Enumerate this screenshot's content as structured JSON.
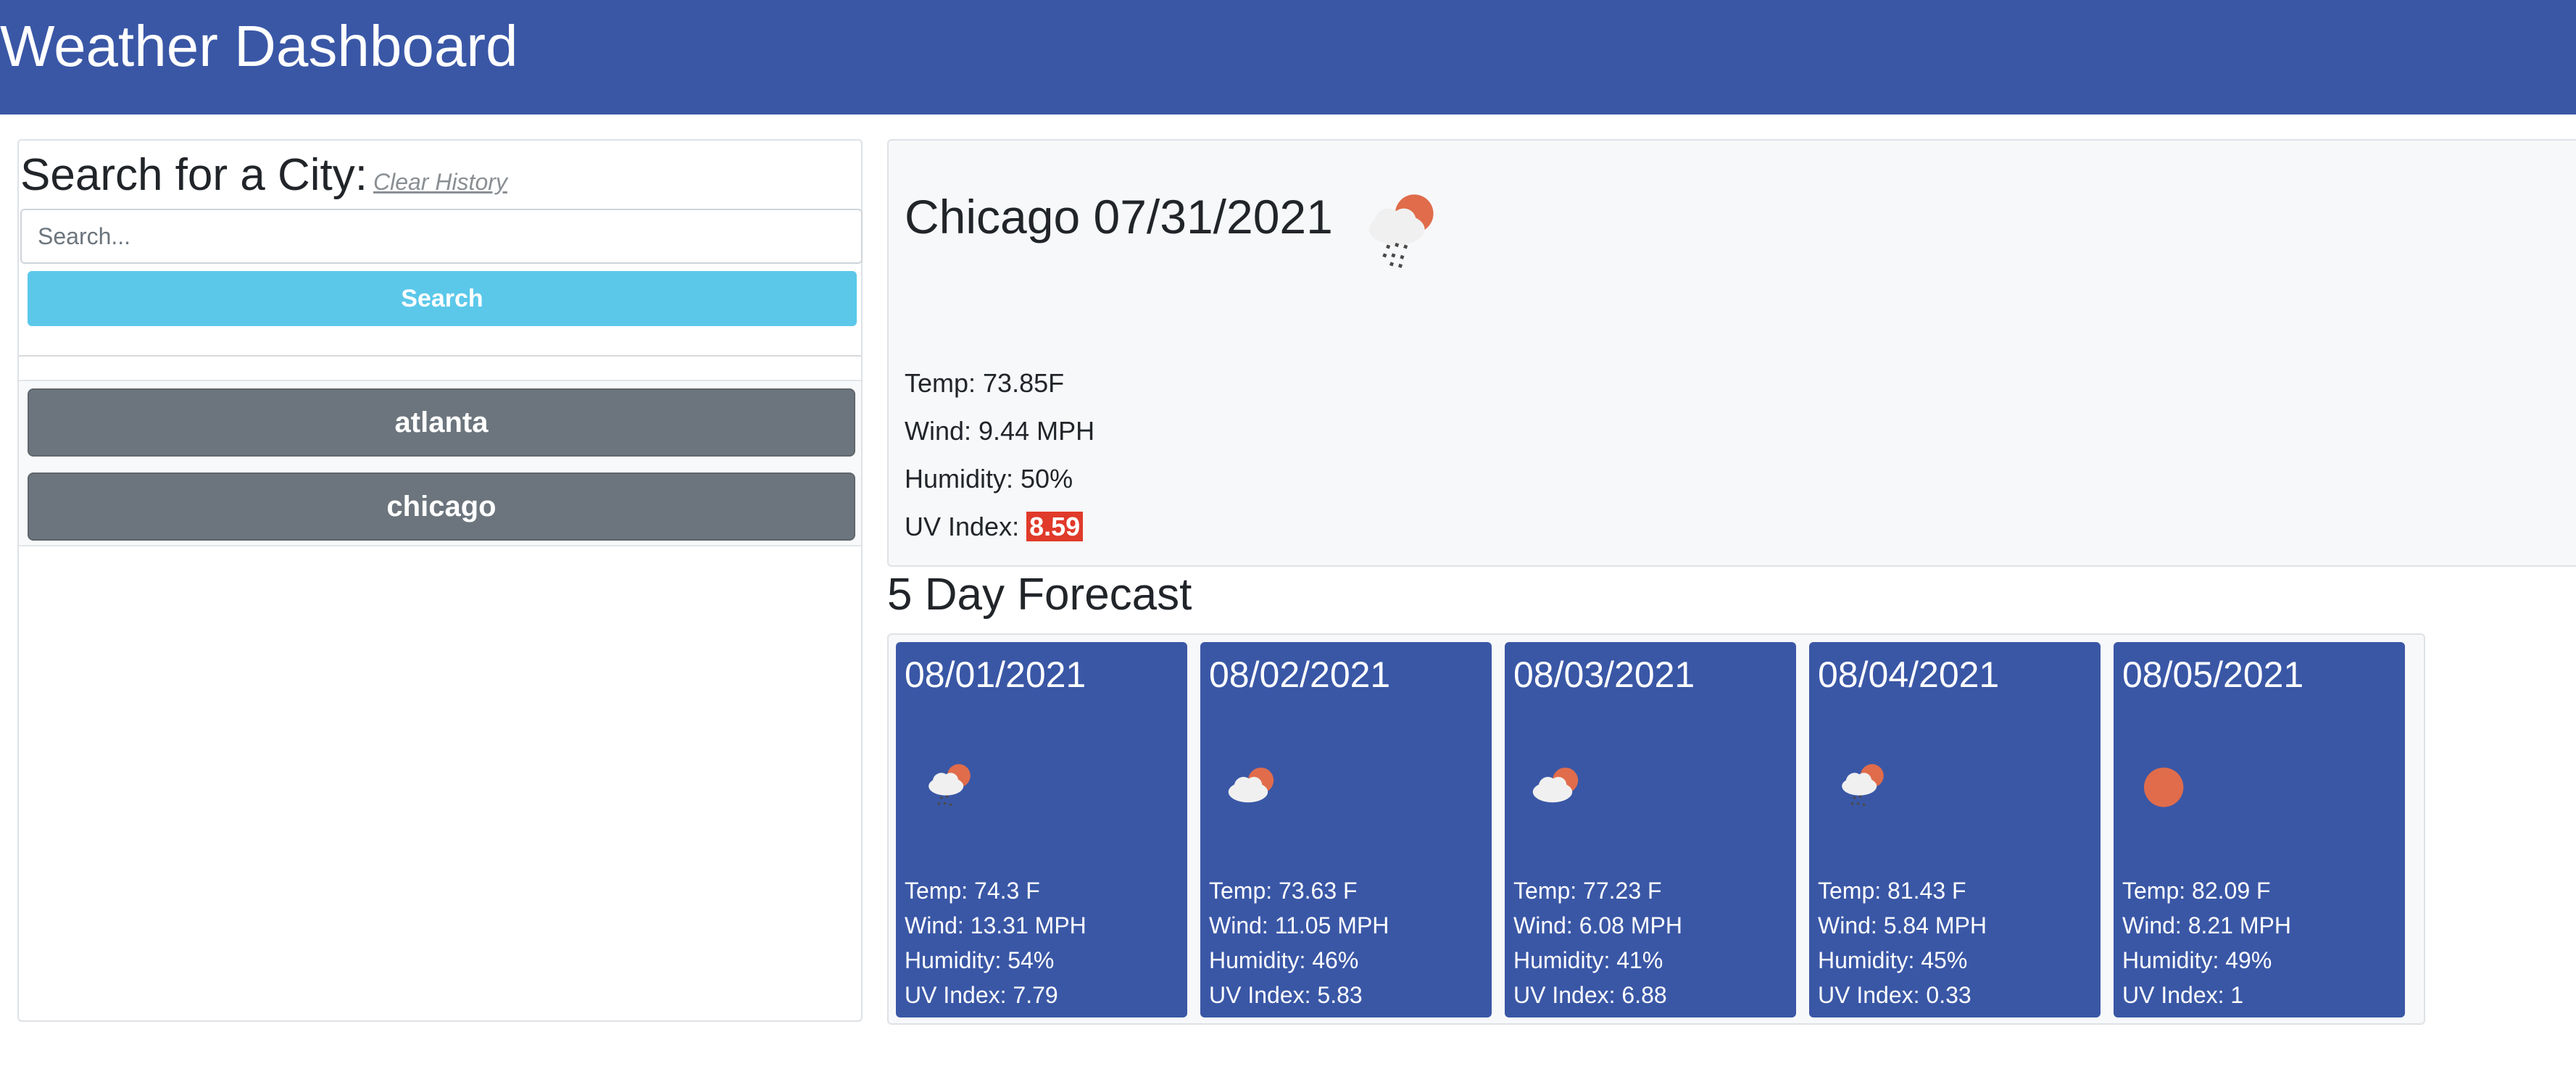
{
  "header": {
    "title": "Weather Dashboard"
  },
  "search": {
    "title": "Search for a City:",
    "clear_label": "Clear History",
    "placeholder": "Search...",
    "button_label": "Search"
  },
  "history": [
    {
      "label": "atlanta"
    },
    {
      "label": "chicago"
    }
  ],
  "current": {
    "title": "Chicago 07/31/2021",
    "icon": "rain-cloud-sun-icon",
    "temp": "Temp: 73.85F",
    "wind": "Wind: 9.44 MPH",
    "humidity": "Humidity: 50%",
    "uv_label": "UV Index: ",
    "uv_value": "8.59",
    "uv_color": "#e03a2a"
  },
  "forecast": {
    "heading": "5 Day Forecast",
    "days": [
      {
        "date": "08/01/2021",
        "icon": "rain-cloud-sun-icon",
        "temp": "Temp: 74.3 F",
        "wind": "Wind: 13.31 MPH",
        "humidity": "Humidity: 54%",
        "uv": "UV Index: 7.79"
      },
      {
        "date": "08/02/2021",
        "icon": "cloud-sun-icon",
        "temp": "Temp: 73.63 F",
        "wind": "Wind: 11.05 MPH",
        "humidity": "Humidity: 46%",
        "uv": "UV Index: 5.83"
      },
      {
        "date": "08/03/2021",
        "icon": "cloud-sun-icon",
        "temp": "Temp: 77.23 F",
        "wind": "Wind: 6.08 MPH",
        "humidity": "Humidity: 41%",
        "uv": "UV Index: 6.88"
      },
      {
        "date": "08/04/2021",
        "icon": "rain-cloud-sun-icon",
        "temp": "Temp: 81.43 F",
        "wind": "Wind: 5.84 MPH",
        "humidity": "Humidity: 45%",
        "uv": "UV Index: 0.33"
      },
      {
        "date": "08/05/2021",
        "icon": "sun-icon",
        "temp": "Temp: 82.09 F",
        "wind": "Wind: 8.21 MPH",
        "humidity": "Humidity: 49%",
        "uv": "UV Index: 1"
      }
    ]
  },
  "colors": {
    "header": "#3a57a6",
    "search_button": "#5bc8ea",
    "history_button": "#6c757d",
    "forecast_card": "#3a57a6",
    "sun": "#e06c4b"
  }
}
